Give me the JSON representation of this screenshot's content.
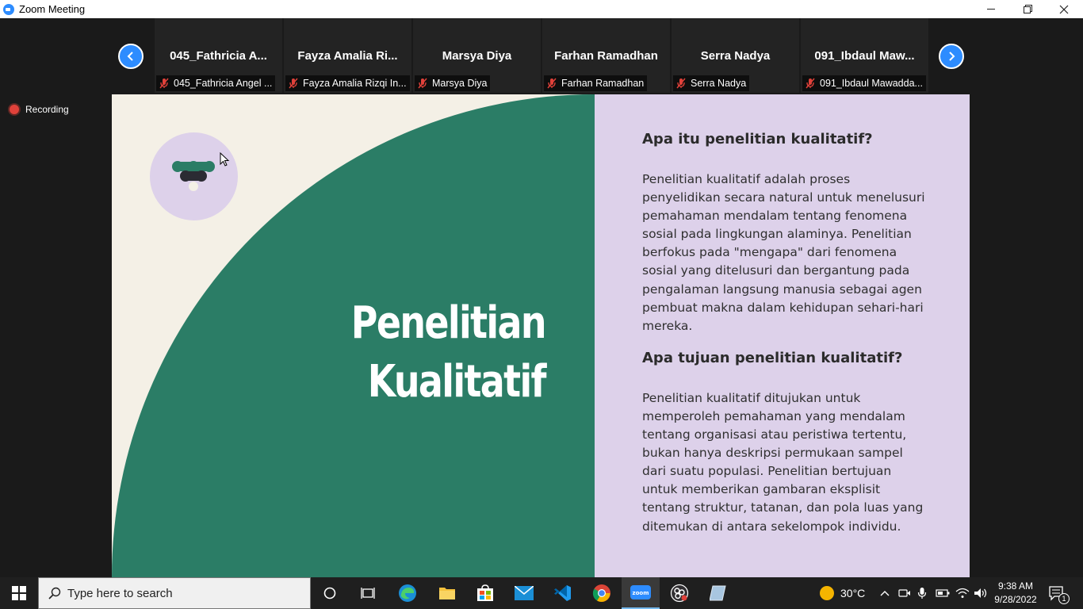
{
  "window": {
    "title": "Zoom Meeting"
  },
  "participants": [
    {
      "display_name": "045_Fathricia A...",
      "tag_name": "045_Fathricia Angel ..."
    },
    {
      "display_name": "Fayza Amalia Ri...",
      "tag_name": "Fayza Amalia Rizqi In..."
    },
    {
      "display_name": "Marsya Diya",
      "tag_name": "Marsya Diya"
    },
    {
      "display_name": "Farhan Ramadhan",
      "tag_name": "Farhan Ramadhan"
    },
    {
      "display_name": "Serra Nadya",
      "tag_name": "Serra Nadya"
    },
    {
      "display_name": "091_Ibdaul  Maw...",
      "tag_name": "091_Ibdaul Mawadda..."
    }
  ],
  "recording": {
    "label": "Recording"
  },
  "slide": {
    "title_line1": "Penelitian",
    "title_line2": "Kualitatif",
    "q1": "Apa itu penelitian kualitatif?",
    "a1": "Penelitian kualitatif adalah proses penyelidikan secara natural untuk menelusuri pemahaman mendalam tentang fenomena sosial pada lingkungan alaminya. Penelitian berfokus pada \"mengapa\" dari fenomena sosial yang ditelusuri dan bergantung pada pengalaman langsung manusia sebagai agen pembuat makna dalam kehidupan sehari-hari mereka.",
    "q2": "Apa tujuan penelitian kualitatif?",
    "a2": "Penelitian kualitatif ditujukan untuk memperoleh pemahaman yang mendalam tentang organisasi atau peristiwa tertentu, bukan hanya deskripsi permukaan sampel dari suatu populasi. Penelitian bertujuan untuk memberikan gambaran eksplisit tentang struktur, tatanan, dan pola luas yang ditemukan di antara sekelompok individu.",
    "colors": {
      "green": "#2b7d66",
      "cream": "#f4f0e6",
      "lavender": "#ddd1ea"
    }
  },
  "taskbar": {
    "search_placeholder": "Type here to search",
    "weather": "30°C",
    "time": "9:38 AM",
    "date": "9/28/2022",
    "notification_count": "1",
    "icons": [
      "windows-start-icon",
      "cortana-icon",
      "task-view-icon",
      "edge-icon",
      "file-explorer-icon",
      "store-icon",
      "mail-icon",
      "vscode-icon",
      "chrome-icon",
      "zoom-icon",
      "obs-icon",
      "notepad-icon"
    ]
  }
}
